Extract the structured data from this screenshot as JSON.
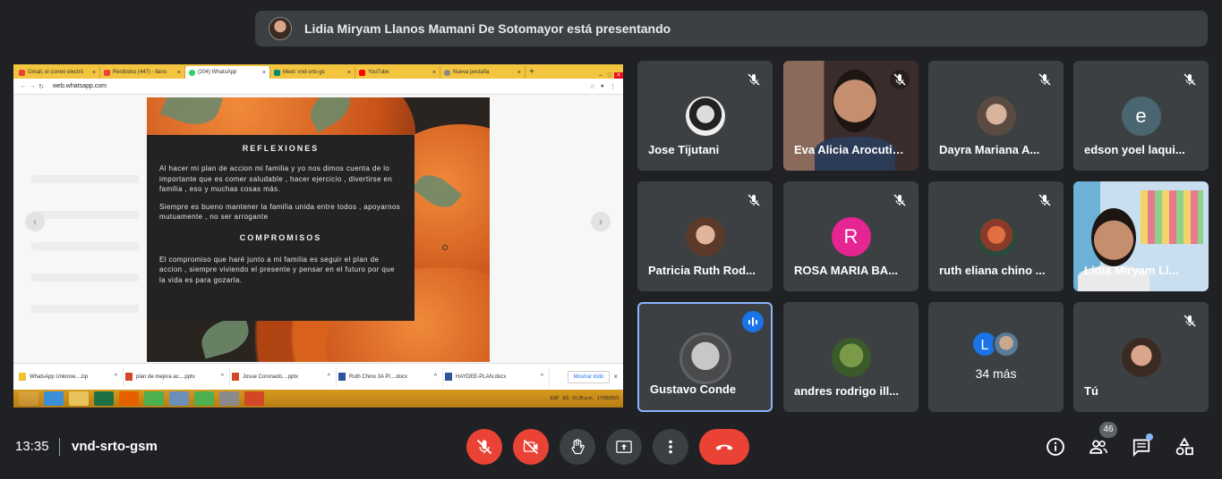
{
  "banner": {
    "text": "Lidia Miryam Llanos Mamani De Sotomayor está presentando"
  },
  "browser": {
    "tabs": [
      "Gmail, el correo electró",
      "Recibidos (447) - llano",
      "(204) WhatsApp",
      "Meet: vnd-srto-gs",
      "YouTube",
      "Nueva pestaña"
    ],
    "url": "web.whatsapp.com"
  },
  "slide": {
    "heading1": "REFLEXIONES",
    "para1": "Al hacer mi plan de accion mi familia y yo nos dimos cuenta de lo importante que es comer saludable , hacer ejercicio , divertirse en familia , eso y muchas cosas más.",
    "para2": "Siempre es bueno mantener la familia unida entre todos , apoyarnos mutuamente , no ser arrogante",
    "heading2": "COMPROMISOS",
    "para3": "El compromiso que haré junto a mi familia es seguir el plan de accion , siempre viviendo el presente y pensar en el futuro por que la vida es para gozarla."
  },
  "downloads": {
    "items": [
      "WhatsApp Unknow....zip",
      "plan de mejora ac....pptx",
      "Josue Coronado....pptx",
      "Ruth Chino 3A Pl....docx",
      "HAYDEE-PLAN.docx"
    ],
    "show_all": "Mostrar todo"
  },
  "taskbar": {
    "lang": "ESP",
    "region": "ES",
    "time": "01:35 p.m.",
    "date": "17/09/2021"
  },
  "participants": [
    {
      "name": "Jose Tijutani"
    },
    {
      "name": "Eva Alicia Arocutipa..."
    },
    {
      "name": "Dayra Mariana A..."
    },
    {
      "name": "edson yoel laqui...",
      "initial": "e"
    },
    {
      "name": "Patricia Ruth Rod..."
    },
    {
      "name": "ROSA MARIA BA...",
      "initial": "R"
    },
    {
      "name": "ruth eliana chino ..."
    },
    {
      "name": "Lidia Miryam Ll..."
    },
    {
      "name": "Gustavo Conde"
    },
    {
      "name": "andres rodrigo ill..."
    },
    {
      "name": "34 más",
      "initial": "L"
    },
    {
      "name": "Tú"
    }
  ],
  "bottom": {
    "time": "13:35",
    "meeting_code": "vnd-srto-gsm",
    "people_count": "46"
  },
  "colors": {
    "bg": "#202124",
    "tile": "#3c4043",
    "red": "#ea4335",
    "accent": "#8ab4f8"
  }
}
